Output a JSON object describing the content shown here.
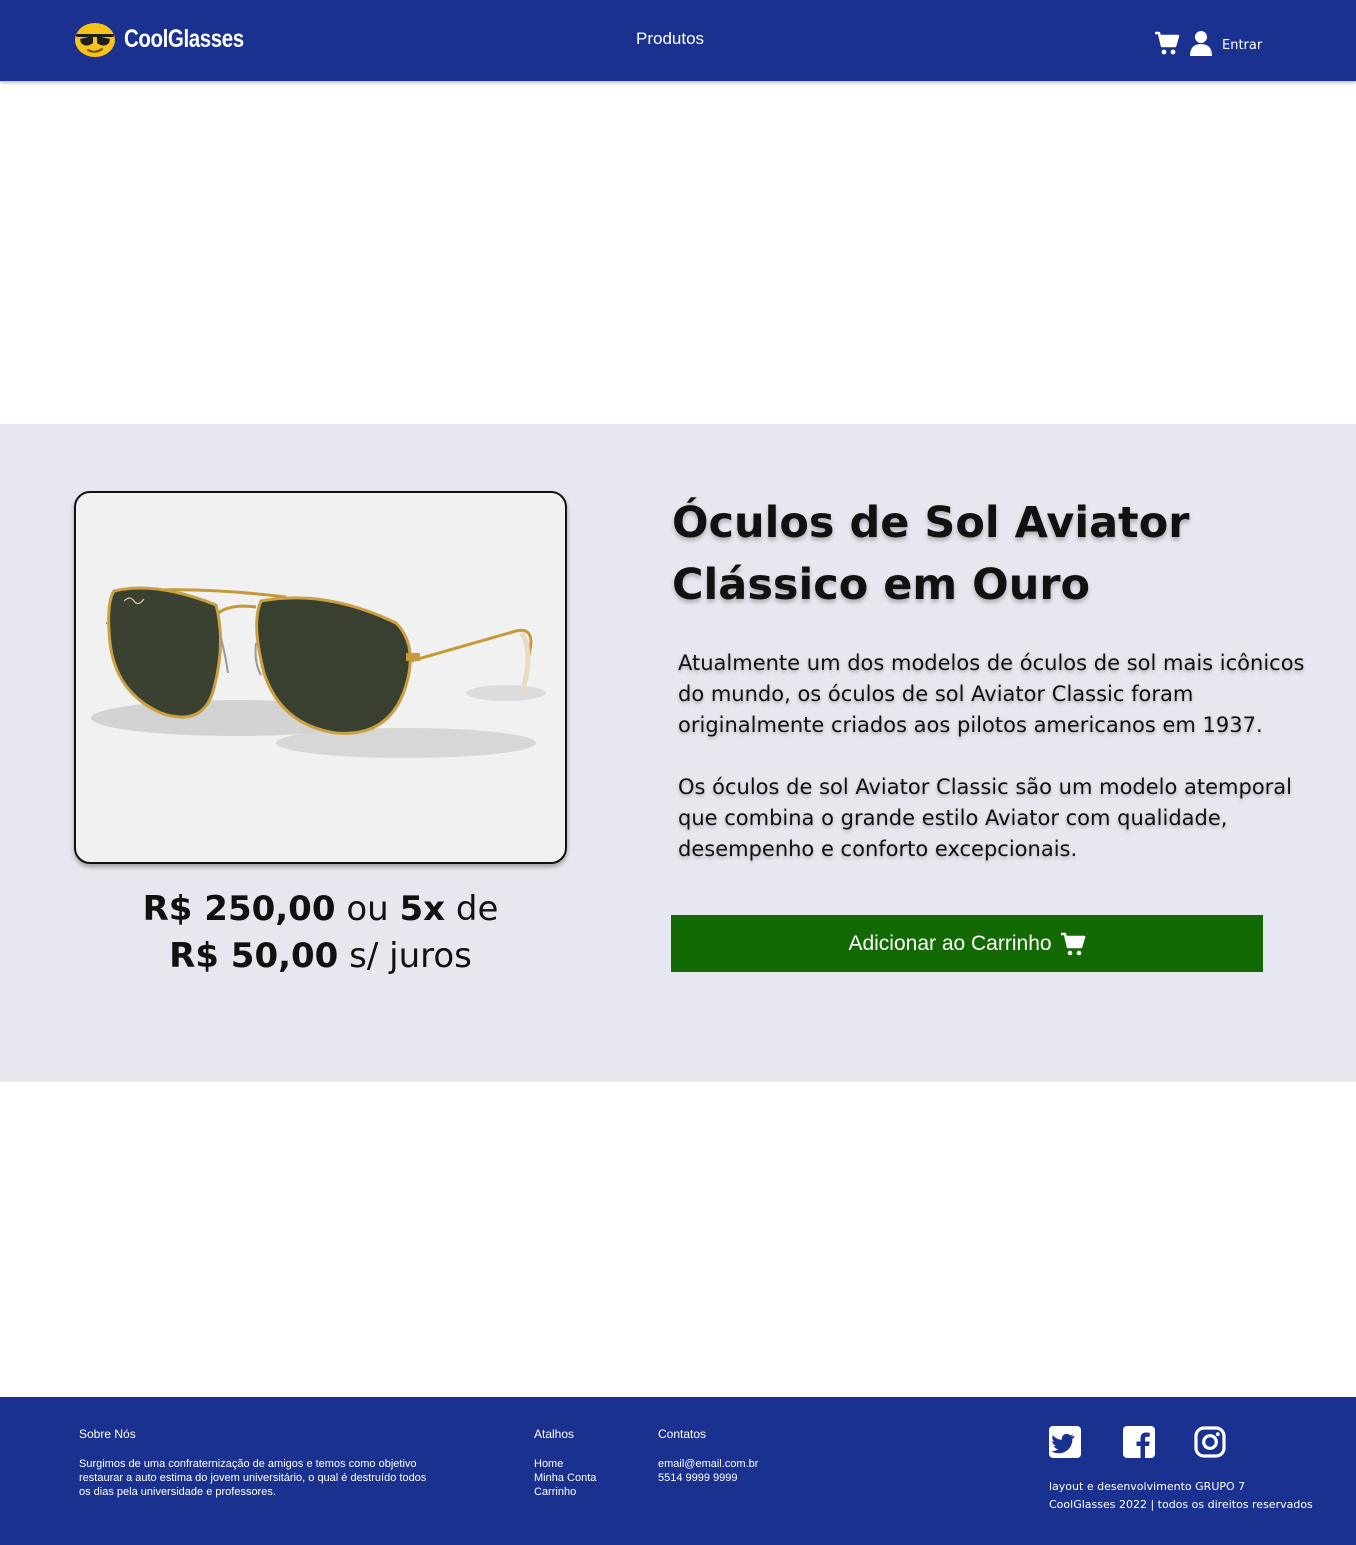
{
  "header": {
    "brand": "CoolGlasses",
    "nav_produtos": "Produtos",
    "login_label": "Entrar",
    "bg_color": "#1a3190"
  },
  "product": {
    "title": "Óculos de Sol Aviator Clássico em Ouro",
    "description_1": "Atualmente um dos modelos de óculos de sol mais icônicos do mundo, os óculos de sol Aviator Classic foram originalmente criados aos pilotos americanos em 1937.",
    "description_2": "Os óculos de sol Aviator Classic são um modelo atemporal que combina o grande estilo Aviator com qualidade, desempenho e conforto excepcionais.",
    "price": "R$ 250,00",
    "price_or": "ou",
    "installments": "5x",
    "price_de": "de",
    "installment_price": "R$ 50,00",
    "installment_suffix": "s/ juros",
    "add_to_cart_label": "Adicionar ao Carrinho",
    "button_color": "#136a04",
    "section_bg": "#e6e7ef",
    "image_icon": "aviator-sunglasses-image"
  },
  "footer": {
    "about_title": "Sobre Nós",
    "about_text": "Surgimos de uma confraternização de amigos e temos como objetivo restaurar a auto estima do jovem universitário, o qual é destruído todos os dias pela universidade e professores.",
    "shortcuts_title": "Atalhos",
    "shortcuts": [
      "Home",
      "Minha Conta",
      "Carrinho"
    ],
    "contacts_title": "Contatos",
    "email": "email@email.com.br",
    "phone": "5514 9999 9999",
    "social_icons": [
      "twitter-icon",
      "facebook-icon",
      "instagram-icon"
    ],
    "credits_1": "layout e desenvolvimento GRUPO 7",
    "credits_2": "CoolGlasses 2022 | todos os direitos reservados"
  }
}
